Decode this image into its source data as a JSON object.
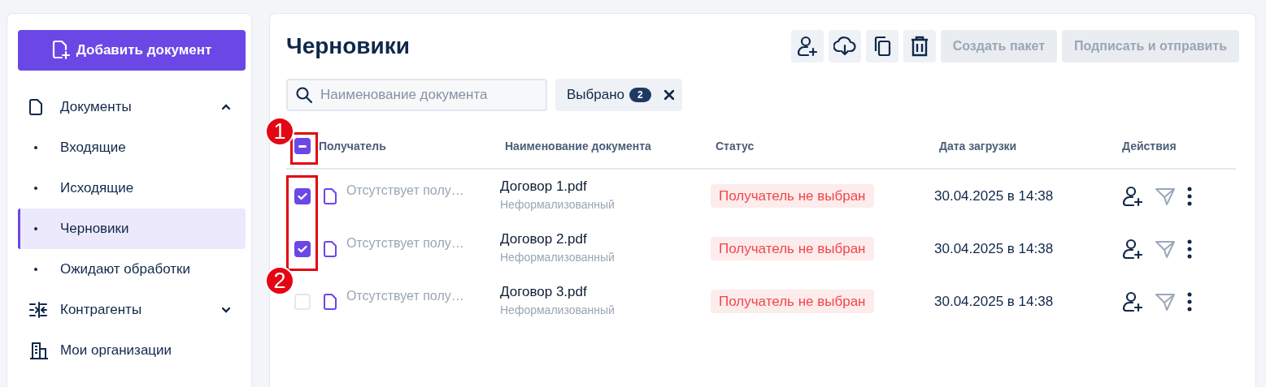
{
  "sidebar": {
    "add_button": "Добавить документ",
    "nav": [
      {
        "label": "Документы",
        "kind": "group",
        "expanded": true,
        "selected": false,
        "children": [
          {
            "label": "Входящие",
            "selected": false
          },
          {
            "label": "Исходящие",
            "selected": false
          },
          {
            "label": "Черновики",
            "selected": true
          },
          {
            "label": "Ожидают обработки",
            "selected": false
          }
        ]
      },
      {
        "label": "Контрагенты",
        "kind": "group",
        "expanded": false,
        "selected": false
      },
      {
        "label": "Мои организации",
        "kind": "link",
        "selected": false
      }
    ]
  },
  "main": {
    "title": "Черновики",
    "buttons": [
      {
        "label": "Создать пакет",
        "disabled": true
      },
      {
        "label": "Подписать и отправить",
        "disabled": true
      }
    ],
    "search": {
      "placeholder": "Наименование документа"
    },
    "selection_chip": {
      "label": "Выбрано",
      "count": "2"
    },
    "table": {
      "select_all": {
        "indeterminate": true
      },
      "columns": [
        "Получатель",
        "Наименование документа",
        "Статус",
        "Дата загрузки",
        "Действия"
      ],
      "rows": [
        {
          "checked": true,
          "recipient": "Отсутствует полу…",
          "name": "Договор 1.pdf",
          "type": "Неформализованный",
          "status": "Получатель не выбран",
          "date": "30.04.2025 в 14:38"
        },
        {
          "checked": true,
          "recipient": "Отсутствует полу…",
          "name": "Договор 2.pdf",
          "type": "Неформализованный",
          "status": "Получатель не выбран",
          "date": "30.04.2025 в 14:38"
        },
        {
          "checked": false,
          "recipient": "Отсутствует полу…",
          "name": "Договор 3.pdf",
          "type": "Неформализованный",
          "status": "Получатель не выбран",
          "date": "30.04.2025 в 14:38"
        }
      ]
    },
    "callouts": [
      {
        "label": "1"
      },
      {
        "label": "2"
      }
    ]
  }
}
